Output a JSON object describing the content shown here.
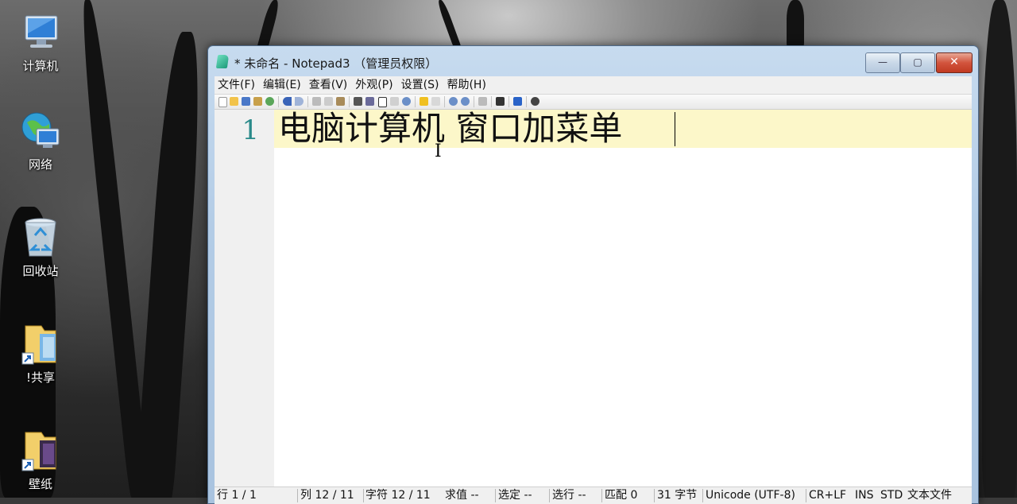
{
  "desktop": {
    "icons": [
      {
        "label": "计算机",
        "icon": "computer-icon"
      },
      {
        "label": "网络",
        "icon": "network-icon"
      },
      {
        "label": "回收站",
        "icon": "recycle-bin-icon"
      },
      {
        "label": "!共享",
        "icon": "shared-folder-shortcut-icon"
      },
      {
        "label": "壁纸",
        "icon": "wallpaper-folder-shortcut-icon"
      }
    ]
  },
  "window": {
    "title": "* 未命名 - Notepad3 （管理员权限）",
    "buttons": {
      "minimize": "—",
      "maximize": "▢",
      "close": "✕"
    },
    "menu": [
      "文件(F)",
      "编辑(E)",
      "查看(V)",
      "外观(P)",
      "设置(S)",
      "帮助(H)"
    ],
    "editor": {
      "line_number": "1",
      "text": "电脑计算机 窗口加菜单",
      "cursor_glyph": "I"
    },
    "status": {
      "line": "行 1 / 1",
      "col": "列 12 / 11",
      "char": "字符 12 / 11",
      "eval": "求值 --",
      "selected": "选定 --",
      "selected_lines": "选行 --",
      "match": "匹配 0",
      "bytes": "31 字节",
      "encoding": "Unicode (UTF-8)",
      "eol": "CR+LF",
      "ins": "INS",
      "std": "STD",
      "filetype": "文本文件"
    },
    "colors": {
      "current_line": "#fcf7c9",
      "line_number": "#2a8a8a",
      "close_button": "#c03a22"
    }
  }
}
